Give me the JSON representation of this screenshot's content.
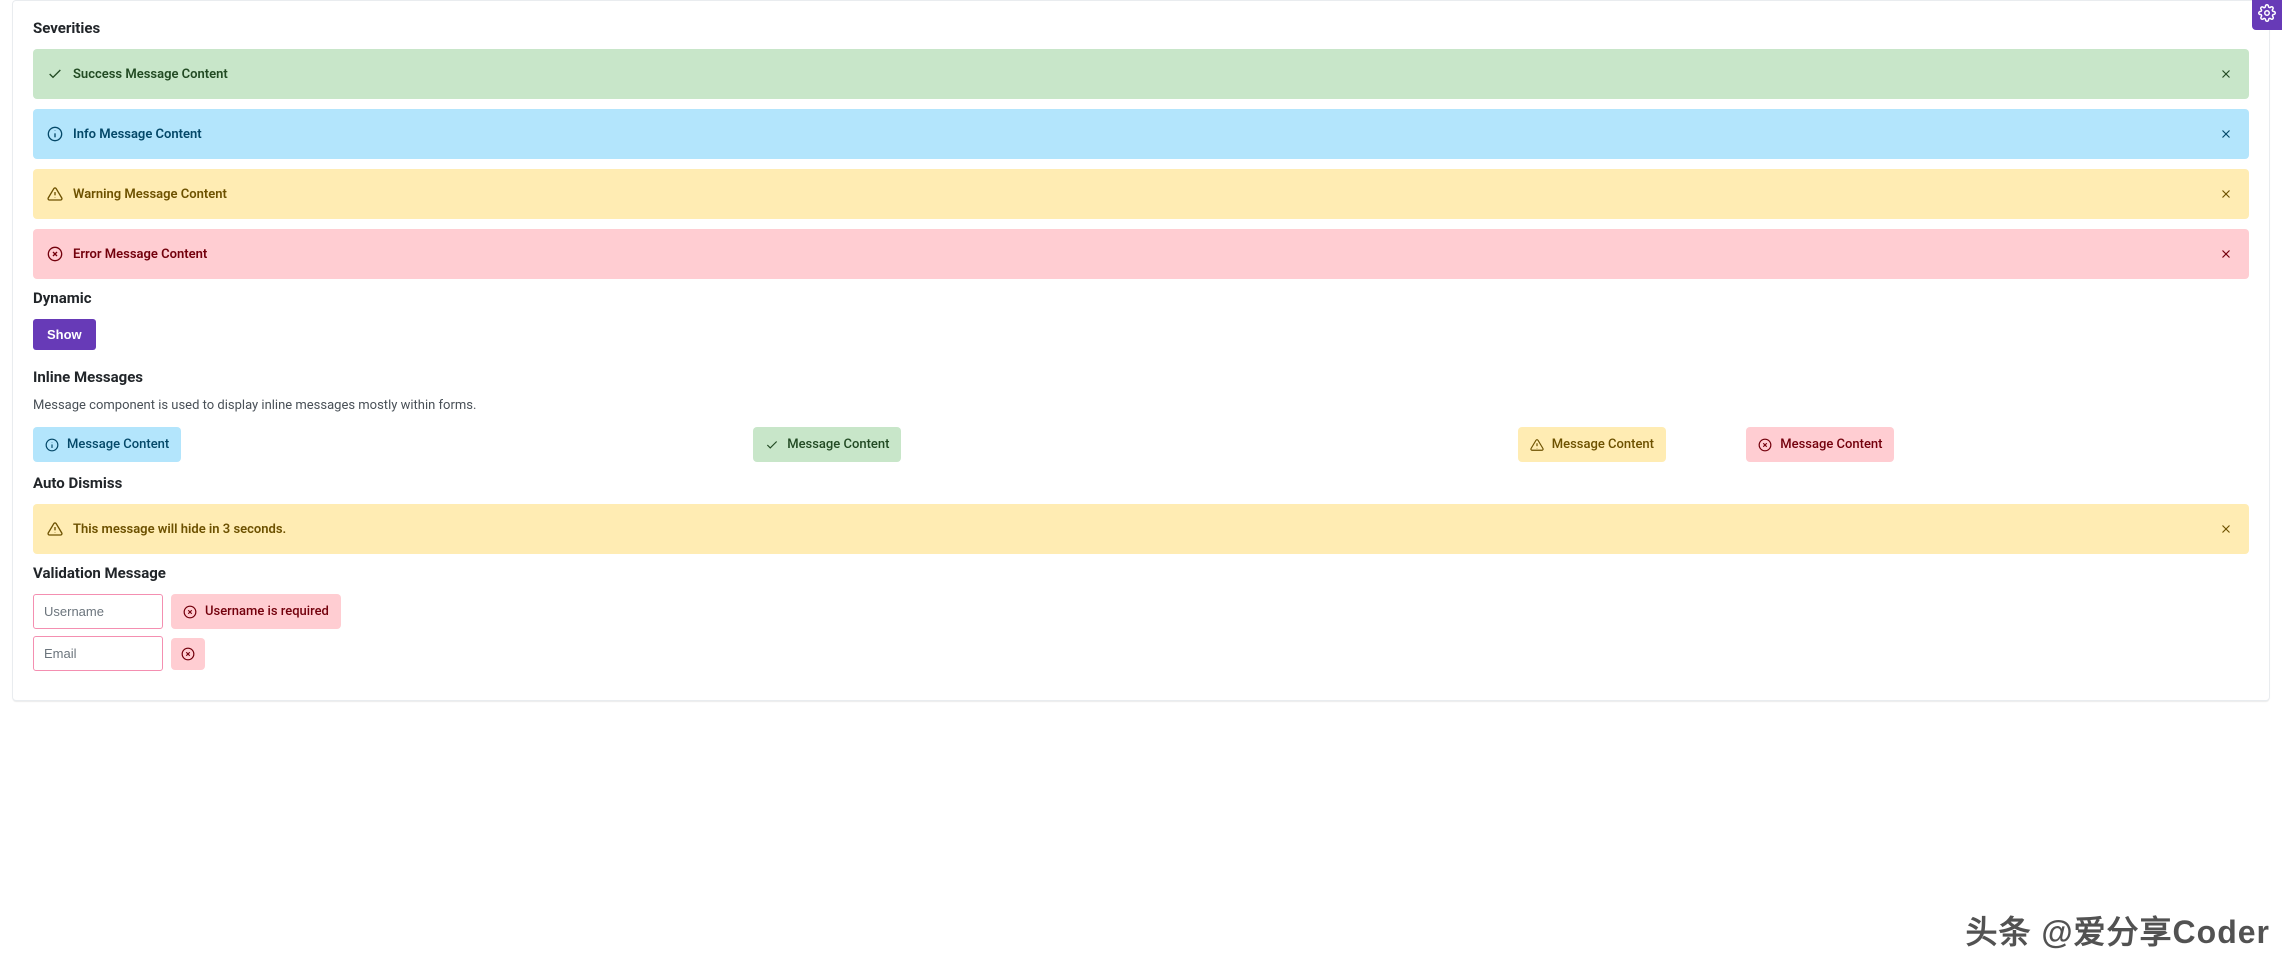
{
  "sections": {
    "severities_title": "Severities",
    "dynamic_title": "Dynamic",
    "inline_title": "Inline Messages",
    "inline_desc": "Message component is used to display inline messages mostly within forms.",
    "auto_dismiss_title": "Auto Dismiss",
    "validation_title": "Validation Message"
  },
  "severity_messages": {
    "success": "Success Message Content",
    "info": "Info Message Content",
    "warn": "Warning Message Content",
    "error": "Error Message Content"
  },
  "dynamic": {
    "show_button": "Show"
  },
  "inline_messages": {
    "info": "Message Content",
    "success": "Message Content",
    "warn": "Message Content",
    "error": "Message Content"
  },
  "auto_dismiss_message": "This message will hide in 3 seconds.",
  "validation": {
    "username_placeholder": "Username",
    "username_error": "Username is required",
    "email_placeholder": "Email"
  },
  "watermark": "头条 @爱分享Coder"
}
